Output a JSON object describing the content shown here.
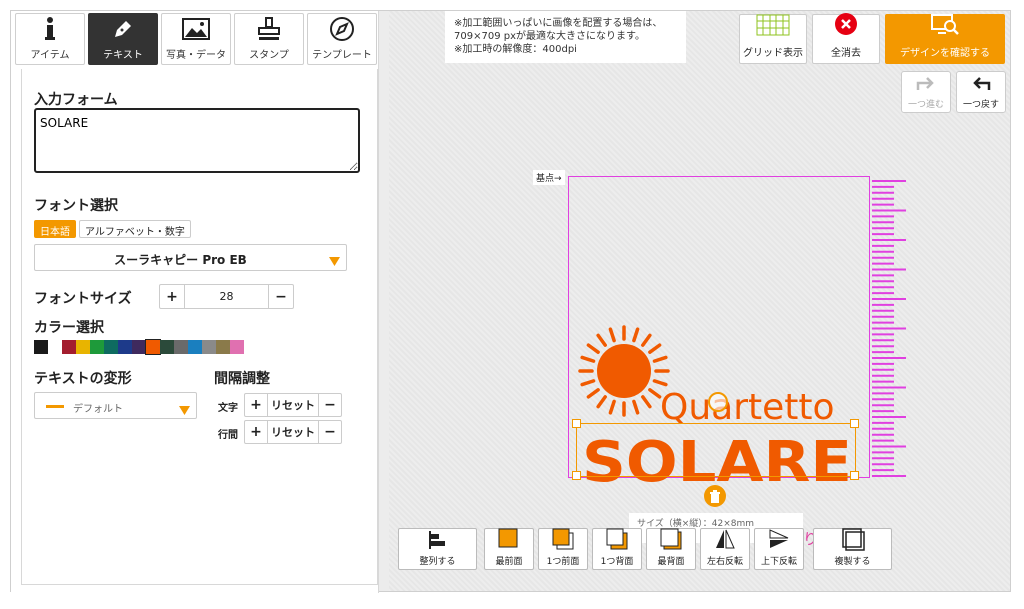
{
  "tabs": [
    {
      "label": "アイテム",
      "icon": "info-icon"
    },
    {
      "label": "テキスト",
      "icon": "pen-icon"
    },
    {
      "label": "写真・データ",
      "icon": "image-icon"
    },
    {
      "label": "スタンプ",
      "icon": "stamp-icon"
    },
    {
      "label": "テンプレート",
      "icon": "compass-icon"
    }
  ],
  "form": {
    "input_title": "入力フォーム",
    "input_value": "SOLARE",
    "font_title": "フォント選択",
    "font_tabs": [
      "日本語",
      "アルファベット・数字"
    ],
    "font_selected": "スーラキャピー Pro EB",
    "size_title": "フォントサイズ",
    "size_value": "28",
    "color_title": "カラー選択",
    "colors": [
      "#1a1a1a",
      "#ffffff",
      "#a31d2e",
      "#e8b400",
      "#1e9a3a",
      "#0e6b60",
      "#1d3a8a",
      "#3f2a5e",
      "#f05a00",
      "#2b4a3a",
      "#6a6a6a",
      "#1a7fbf",
      "#8a8a8a",
      "#8a7a4a",
      "#e070b0"
    ],
    "transform_title": "テキストの変形",
    "transform_value": "デフォルト",
    "spacing_title": "間隔調整",
    "char_label": "文字",
    "line_label": "行間",
    "reset_label": "リセット"
  },
  "notice": [
    "※加工範囲いっぱいに画像を配置する場合は、",
    "709×709 pxが最適な大きさになります。",
    "※加工時の解像度：400dpi"
  ],
  "toolbar": {
    "grid": "グリッド表示",
    "clear": "全消去",
    "confirm": "デザインを確認する",
    "redo": "一つ進む",
    "undo": "一つ戻す"
  },
  "canvas": {
    "origin": "基点→",
    "logo_top": "Quartetto",
    "logo_main": "SOLARE",
    "size_info": "サイズ（横×縦）：42×8mm",
    "pink_text": "ります。"
  },
  "bottom": [
    "整列する",
    "最前面",
    "1つ前面",
    "1つ背面",
    "最背面",
    "左右反転",
    "上下反転",
    "複製する"
  ],
  "accent": "#f39800",
  "guide": "#e040e0"
}
